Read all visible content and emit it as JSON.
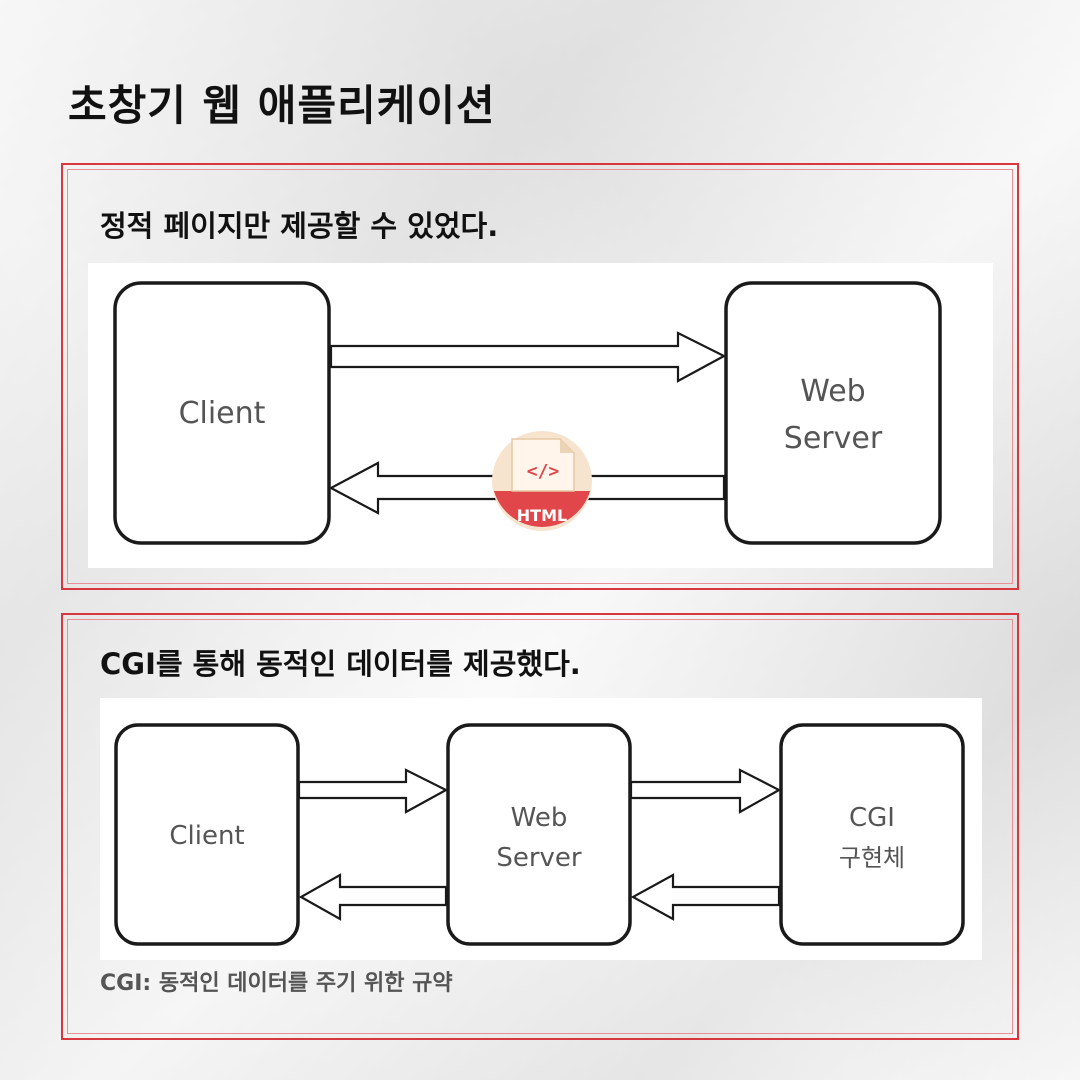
{
  "page": {
    "title": "초창기 웹 애플리케이션"
  },
  "static_section": {
    "heading": "정적 페이지만 제공할 수 있었다.",
    "client_label": "Client",
    "server_label_line1": "Web",
    "server_label_line2": "Server",
    "html_badge_code": "</>",
    "html_badge_label": "HTML"
  },
  "cgi_section": {
    "heading": "CGI를 통해 동적인 데이터를 제공했다.",
    "client_label": "Client",
    "server_label_line1": "Web",
    "server_label_line2": "Server",
    "cgi_label_line1": "CGI",
    "cgi_label_line2": "구현체",
    "footnote": "CGI: 동적인 데이터를 주기 위한 규약"
  },
  "colors": {
    "border_red": "#d9373f",
    "badge_red": "#e0464a",
    "badge_bg": "#f7e4cf",
    "label_gray": "#555555"
  }
}
